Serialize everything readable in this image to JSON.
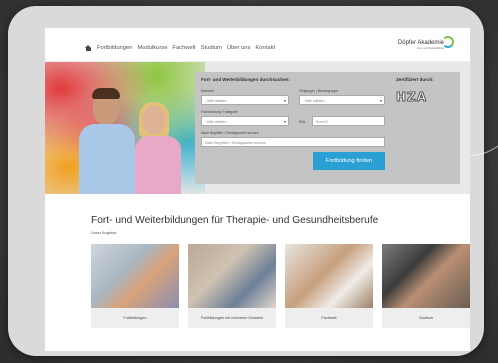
{
  "nav": {
    "items": [
      "Fortbildungen",
      "Modulkurse",
      "Fachwelt",
      "Studium",
      "Über uns",
      "Kontakt"
    ]
  },
  "logo": {
    "name": "Döpfer Akademie",
    "sub": "Fort- und Weiterbildung"
  },
  "search": {
    "heading": "Fort- und Weiterbildungen durchsuchen:",
    "standort_label": "Standort",
    "standort_value": "- bitte wählen -",
    "zielgruppe_label": "Zielgruppe | Berufsgruppe",
    "zielgruppe_value": "- bitte wählen -",
    "fachrichtung_label": "Fachrichtung / Kategorie",
    "fachrichtung_value": "- bitte wählen -",
    "id_label": "ID#",
    "id_placeholder": "Kurs ID",
    "keyword_label": "Nach Begriffen / Schlagworten suchen",
    "keyword_placeholder": "Nach Begriffen / Schlagworten suchen",
    "button": "Fortbildung finden"
  },
  "certified": {
    "label": "Zertifiziert durch:",
    "mark": "HZA"
  },
  "main": {
    "title": "Fort- und Weiterbildungen für Therapie- und Gesundheitsberufe",
    "subtitle": "Unser Angebot:",
    "cards": [
      {
        "label": "Fortbildungen"
      },
      {
        "label": "Fortbildungen mit mehreren Modulen"
      },
      {
        "label": "Fachwelt"
      },
      {
        "label": "Studium"
      }
    ]
  },
  "colors": {
    "accent": "#2aa0d4",
    "panel": "#c4c4c4"
  }
}
